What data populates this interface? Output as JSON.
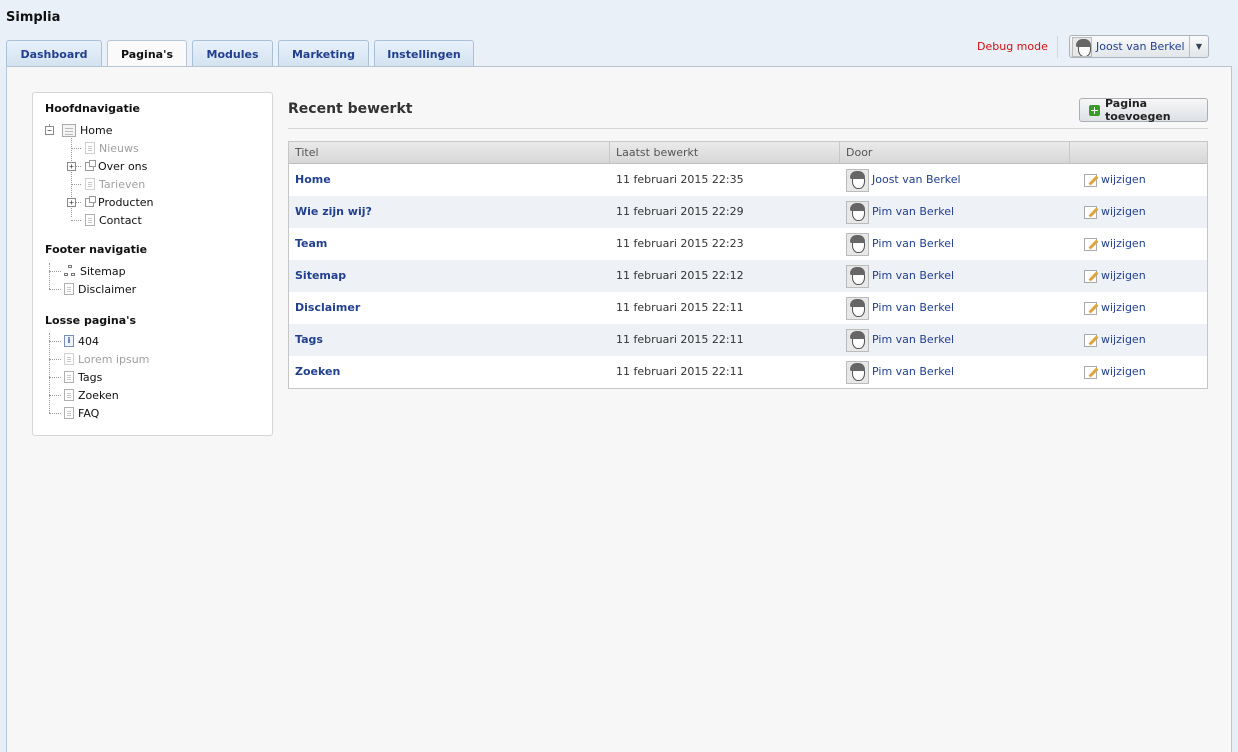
{
  "app": {
    "title": "Simplia"
  },
  "tabs": [
    {
      "label": "Dashboard",
      "active": false
    },
    {
      "label": "Pagina's",
      "active": true
    },
    {
      "label": "Modules",
      "active": false
    },
    {
      "label": "Marketing",
      "active": false
    },
    {
      "label": "Instellingen",
      "active": false
    }
  ],
  "header": {
    "debug_label": "Debug mode",
    "user_name": "Joost van Berkel",
    "user_menu_icon": "caret-down-icon"
  },
  "sidebar": {
    "sections": [
      {
        "title": "Hoofdnavigatie",
        "items": [
          {
            "label": "Home",
            "icon": "home-page-icon",
            "state": "normal",
            "expandable": true
          },
          {
            "label": "Nieuws",
            "icon": "page-icon",
            "state": "disabled"
          },
          {
            "label": "Over ons",
            "icon": "link-page-icon",
            "state": "normal",
            "expandable": true
          },
          {
            "label": "Tarieven",
            "icon": "page-icon",
            "state": "disabled"
          },
          {
            "label": "Producten",
            "icon": "link-page-icon",
            "state": "normal",
            "expandable": true
          },
          {
            "label": "Contact",
            "icon": "page-icon",
            "state": "normal"
          }
        ]
      },
      {
        "title": "Footer navigatie",
        "items": [
          {
            "label": "Sitemap",
            "icon": "sitemap-icon",
            "state": "normal"
          },
          {
            "label": "Disclaimer",
            "icon": "page-icon",
            "state": "normal"
          }
        ]
      },
      {
        "title": "Losse pagina's",
        "items": [
          {
            "label": "404",
            "icon": "info-page-icon",
            "state": "normal"
          },
          {
            "label": "Lorem ipsum",
            "icon": "page-icon",
            "state": "disabled"
          },
          {
            "label": "Tags",
            "icon": "page-icon",
            "state": "normal"
          },
          {
            "label": "Zoeken",
            "icon": "page-icon",
            "state": "normal"
          },
          {
            "label": "FAQ",
            "icon": "page-icon",
            "state": "normal"
          }
        ]
      }
    ]
  },
  "content": {
    "title": "Recent bewerkt",
    "add_button_label": "Pagina toevoegen",
    "table": {
      "columns": [
        "Titel",
        "Laatst bewerkt",
        "Door",
        ""
      ],
      "rows": [
        {
          "title": "Home",
          "date": "11 februari 2015 22:35",
          "by": "Joost van Berkel",
          "action": "wijzigen"
        },
        {
          "title": "Wie zijn wij?",
          "date": "11 februari 2015 22:29",
          "by": "Pim van Berkel",
          "action": "wijzigen"
        },
        {
          "title": "Team",
          "date": "11 februari 2015 22:23",
          "by": "Pim van Berkel",
          "action": "wijzigen"
        },
        {
          "title": "Sitemap",
          "date": "11 februari 2015 22:12",
          "by": "Pim van Berkel",
          "action": "wijzigen"
        },
        {
          "title": "Disclaimer",
          "date": "11 februari 2015 22:11",
          "by": "Pim van Berkel",
          "action": "wijzigen"
        },
        {
          "title": "Tags",
          "date": "11 februari 2015 22:11",
          "by": "Pim van Berkel",
          "action": "wijzigen"
        },
        {
          "title": "Zoeken",
          "date": "11 februari 2015 22:11",
          "by": "Pim van Berkel",
          "action": "wijzigen"
        }
      ]
    }
  }
}
